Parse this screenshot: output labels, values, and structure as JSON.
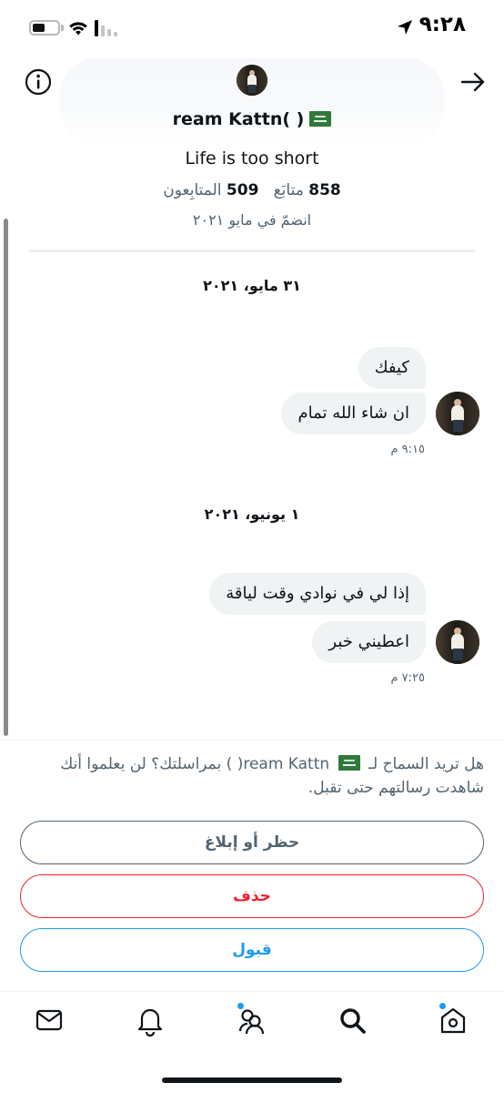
{
  "status_bar": {
    "time": "٩:٢٨",
    "battery_level": 0.5
  },
  "header": {
    "info_icon": "info-circle-icon",
    "back_icon": "arrow-right-icon",
    "name": "ream Kattn( )",
    "bio": "Life is too short",
    "following_count": "858",
    "following_label": "متابَع",
    "followers_count": "509",
    "followers_label": "المتابِعون",
    "joined": "انضمّ في مايو ٢٠٢١"
  },
  "conversation": {
    "groups": [
      {
        "date": "٣١ مايو، ٢٠٢١",
        "messages": [
          "كيفك",
          "ان شاء الله تمام"
        ],
        "time": "٩:١٥ م"
      },
      {
        "date": "١ يونيو، ٢٠٢١",
        "messages": [
          "إذا لي في نوادي وقت لياقة",
          "اعطيني خبر"
        ],
        "time": "٧:٢٥ م"
      }
    ]
  },
  "request": {
    "text_before": "هل تريد السماح لـ",
    "text_name": "ream Kattn( )",
    "text_after": "بمراسلتك؟ لن يعلموا أنك شاهدت رسالتهم حتى تقبل.",
    "block_label": "حظر أو إبلاغ",
    "delete_label": "حذف",
    "accept_label": "قبول"
  },
  "tab_bar": {
    "items": [
      "mail-icon",
      "bell-icon",
      "people-icon",
      "search-icon",
      "home-icon"
    ]
  },
  "colors": {
    "accent": "#1d9bf0",
    "danger": "#f4212e",
    "muted": "#536471"
  }
}
